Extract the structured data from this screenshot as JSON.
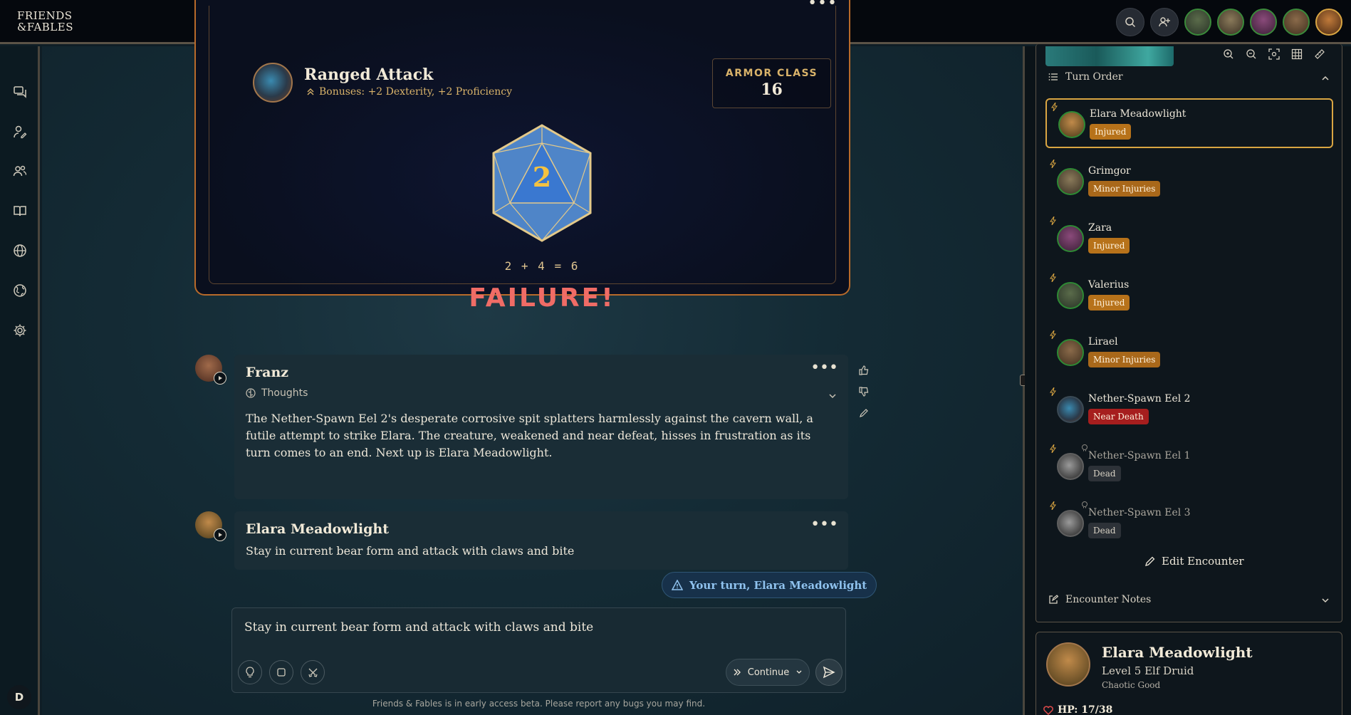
{
  "app": {
    "logo_line1": "FRIENDS",
    "logo_line2": "&FABLES"
  },
  "roll": {
    "title": "Ranged Attack",
    "bonuses": "Bonuses: +2 Dexterity, +2 Proficiency",
    "armor_class_label": "ARMOR CLASS",
    "armor_class_value": "16",
    "die_value": "2",
    "math": "2 + 4 = 6",
    "result": "FAILURE!"
  },
  "messages": [
    {
      "author": "Franz",
      "thoughts_label": "Thoughts",
      "text": "The Nether-Spawn Eel 2's desperate corrosive spit splatters harmlessly against the cavern wall, a futile attempt to strike Elara. The creature, weakened and near defeat, hisses in frustration as its turn comes to an end. Next up is Elara Meadowlight."
    },
    {
      "author": "Elara Meadowlight",
      "text": "Stay in current bear form and attack with claws and bite"
    }
  ],
  "turn_notice": "Your turn, Elara Meadowlight",
  "composer": {
    "text": "Stay in current bear form and attack with claws and bite",
    "continue_label": "Continue"
  },
  "footer_note": "Friends & Fables is in early access beta. Please report any bugs you may find.",
  "user_initial": "D",
  "turn_order": {
    "title": "Turn Order",
    "combatants": [
      {
        "name": "Elara Meadowlight",
        "status": "Injured"
      },
      {
        "name": "Grimgor",
        "status": "Minor Injuries"
      },
      {
        "name": "Zara",
        "status": "Injured"
      },
      {
        "name": "Valerius",
        "status": "Injured"
      },
      {
        "name": "Lirael",
        "status": "Minor Injuries"
      },
      {
        "name": "Nether-Spawn Eel 2",
        "status": "Near Death"
      },
      {
        "name": "Nether-Spawn Eel 1",
        "status": "Dead"
      },
      {
        "name": "Nether-Spawn Eel 3",
        "status": "Dead"
      }
    ],
    "edit_label": "Edit Encounter",
    "notes_label": "Encounter Notes"
  },
  "character": {
    "name": "Elara Meadowlight",
    "class_line": "Level 5 Elf Druid",
    "alignment": "Chaotic Good",
    "hp": "HP: 17/38"
  },
  "colors": {
    "accent_gold": "#d9a542",
    "failure_red": "#f06c66",
    "injured": "#b7721a",
    "near_death": "#a61e1e",
    "turn_blue": "#8fc2ee"
  }
}
